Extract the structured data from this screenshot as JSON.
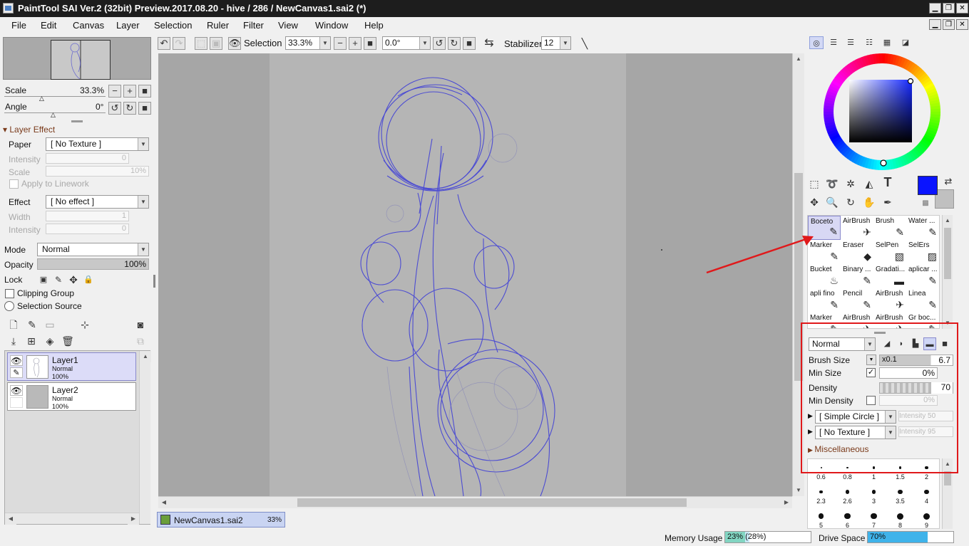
{
  "window": {
    "title": "PaintTool SAI Ver.2 (32bit) Preview.2017.08.20 - hive / 286 / NewCanvas1.sai2 (*)",
    "min": "▁",
    "restore": "❐",
    "close": "✕"
  },
  "menu": [
    "File",
    "Edit",
    "Canvas",
    "Layer",
    "Selection",
    "Ruler",
    "Filter",
    "View",
    "Window",
    "Help"
  ],
  "navigator": {
    "scale_label": "Scale",
    "scale_value": "33.3%",
    "angle_label": "Angle",
    "angle_value": "0°"
  },
  "layer_effect": {
    "header": "Layer Effect",
    "paper_label": "Paper",
    "paper_value": "[ No Texture ]",
    "intensity_label": "Intensity",
    "intensity_value": "0",
    "scale_label": "Scale",
    "scale_value": "10%",
    "apply_linework": "Apply to Linework",
    "effect_label": "Effect",
    "effect_value": "[ No effect ]",
    "width_label": "Width",
    "width_value": "1",
    "intensity2_label": "Intensity",
    "intensity2_value": "0"
  },
  "layer_props": {
    "mode_label": "Mode",
    "mode_value": "Normal",
    "opacity_label": "Opacity",
    "opacity_value": "100%",
    "lock_label": "Lock",
    "clipping_group": "Clipping Group",
    "selection_source": "Selection Source"
  },
  "layers": [
    {
      "name": "Layer1",
      "mode": "Normal",
      "opacity": "100%"
    },
    {
      "name": "Layer2",
      "mode": "Normal",
      "opacity": "100%"
    }
  ],
  "toolbar": {
    "selection_label": "Selection",
    "zoom_value": "33.3%",
    "rotation_value": "0.0°",
    "stabilizer_label": "Stabilizer",
    "stabilizer_value": "12"
  },
  "document_tab": {
    "name": "NewCanvas1.sai2",
    "zoom": "33%"
  },
  "brushes": [
    {
      "label": "Boceto",
      "icon": "✎"
    },
    {
      "label": "AirBrush",
      "icon": "✈"
    },
    {
      "label": "Brush",
      "icon": "✎"
    },
    {
      "label": "Water ...",
      "icon": "✎"
    },
    {
      "label": "Marker",
      "icon": "✎"
    },
    {
      "label": "Eraser",
      "icon": "◆"
    },
    {
      "label": "SelPen",
      "icon": "▧"
    },
    {
      "label": "SelErs",
      "icon": "▨"
    },
    {
      "label": "Bucket",
      "icon": "♨"
    },
    {
      "label": "Binary ...",
      "icon": "✎"
    },
    {
      "label": "Gradati...",
      "icon": "▬"
    },
    {
      "label": "aplicar ...",
      "icon": "✎"
    },
    {
      "label": "apli fino",
      "icon": "✎"
    },
    {
      "label": "Pencil",
      "icon": "✎"
    },
    {
      "label": "AirBrush",
      "icon": "✈"
    },
    {
      "label": "Linea",
      "icon": "✎"
    },
    {
      "label": "Marker",
      "icon": "✎"
    },
    {
      "label": "AirBrush",
      "icon": "✈"
    },
    {
      "label": "AirBrush",
      "icon": "✈"
    },
    {
      "label": "Gr boc...",
      "icon": "✎"
    }
  ],
  "brush_settings": {
    "blend_mode": "Normal",
    "brush_size_label": "Brush Size",
    "brush_size_mult": "x0.1",
    "brush_size_value": "6.7",
    "min_size_label": "Min Size",
    "min_size_value": "0%",
    "density_label": "Density",
    "density_value": "70",
    "min_density_label": "Min Density",
    "min_density_value": "0%",
    "shape_value": "[ Simple Circle ]",
    "shape_intensity": "Intensity 50",
    "texture_value": "[ No Texture ]",
    "texture_intensity": "Intensity 95",
    "misc_label": "Miscellaneous"
  },
  "brush_sizes": [
    "0.6",
    "0.8",
    "1",
    "1.5",
    "2",
    "2.3",
    "2.6",
    "3",
    "3.5",
    "4",
    "5",
    "6",
    "7",
    "8",
    "9"
  ],
  "status": {
    "memory_label": "Memory Usage",
    "memory_value": "23% (28%)",
    "memory_fraction": 0.23,
    "drive_label": "Drive Space",
    "drive_value": "70%",
    "drive_fraction": 0.7
  },
  "colors": {
    "primary": "#0a14ff",
    "secondary": "#c0c0c0",
    "accent_red": "#e0191b",
    "sketch": "#3a3ad8"
  }
}
